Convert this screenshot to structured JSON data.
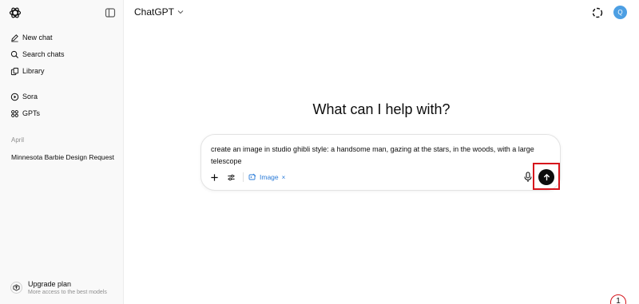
{
  "header": {
    "model_name": "ChatGPT",
    "avatar_initial": "Q"
  },
  "sidebar": {
    "items": [
      {
        "label": "New chat",
        "icon": "edit-icon"
      },
      {
        "label": "Search chats",
        "icon": "search-icon"
      },
      {
        "label": "Library",
        "icon": "library-icon"
      },
      {
        "label": "Sora",
        "icon": "sora-icon"
      },
      {
        "label": "GPTs",
        "icon": "gpts-icon"
      }
    ],
    "section_label": "April",
    "chats": [
      {
        "title": "Minnesota Barbie Design Request"
      }
    ],
    "upgrade": {
      "title": "Upgrade plan",
      "subtitle": "More access to the best models"
    }
  },
  "main": {
    "headline": "What can I help with?",
    "composer": {
      "text": "create an image in studio ghibli style: a handsome man, gazing at the stars, in the woods, with a large telescope",
      "chip_label": "Image",
      "chip_close": "×"
    }
  },
  "overlay": {
    "step_number": "1",
    "highlight_color": "#d6151c"
  },
  "colors": {
    "accent": "#2a7bd8",
    "avatar": "#4d9fe3",
    "sidebar_bg": "#f9f9f9"
  }
}
